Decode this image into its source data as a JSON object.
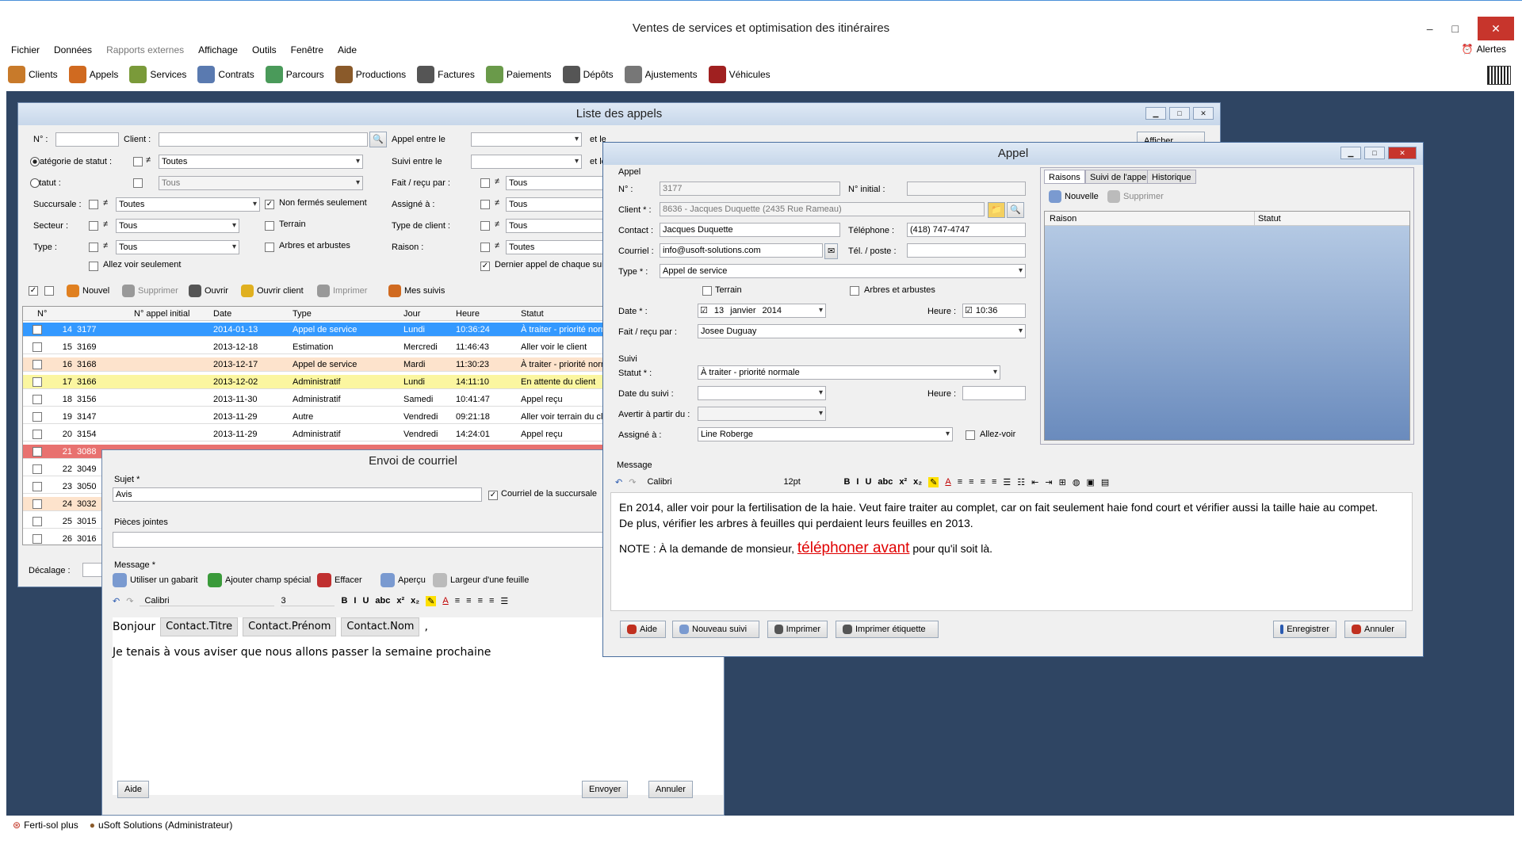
{
  "app": {
    "title": "Ventes de services et optimisation des itinéraires",
    "alerts": "Alertes"
  },
  "menu": [
    "Fichier",
    "Données",
    "Rapports externes",
    "Affichage",
    "Outils",
    "Fenêtre",
    "Aide"
  ],
  "toolbar": [
    {
      "label": "Clients",
      "icon": "clients-icon",
      "color": "#c87a2a"
    },
    {
      "label": "Appels",
      "icon": "appels-icon",
      "color": "#d06a20"
    },
    {
      "label": "Services",
      "icon": "services-icon",
      "color": "#7a9a3a"
    },
    {
      "label": "Contrats",
      "icon": "contrats-icon",
      "color": "#5a7ab0"
    },
    {
      "label": "Parcours",
      "icon": "parcours-icon",
      "color": "#4a9a5a"
    },
    {
      "label": "Productions",
      "icon": "productions-icon",
      "color": "#8a5a2a"
    },
    {
      "label": "Factures",
      "icon": "factures-icon",
      "color": "#555"
    },
    {
      "label": "Paiements",
      "icon": "paiements-icon",
      "color": "#6a9a4a"
    },
    {
      "label": "Dépôts",
      "icon": "depots-icon",
      "color": "#555"
    },
    {
      "label": "Ajustements",
      "icon": "ajustements-icon",
      "color": "#777"
    },
    {
      "label": "Véhicules",
      "icon": "vehicules-icon",
      "color": "#a02020"
    }
  ],
  "liste": {
    "title": "Liste des appels",
    "labels": {
      "no": "N° :",
      "client": "Client :",
      "categorie": "Catégorie de statut :",
      "statut": "Statut :",
      "succursale": "Succursale :",
      "secteur": "Secteur :",
      "type": "Type :",
      "appel_entre": "Appel entre le",
      "suivi_entre": "Suivi entre le",
      "et_le": "et le",
      "fait_recu": "Fait / reçu par :",
      "assigne": "Assigné à :",
      "type_client": "Type de client :",
      "raison": "Raison :",
      "non_fermes": "Non fermés seulement",
      "terrain": "Terrain",
      "arbres": "Arbres et arbustes",
      "allez_voir": "Allez voir seulement",
      "dernier": "Dernier appel de chaque sui",
      "decalage": "Décalage :",
      "afficher": "Afficher",
      "ne": "≠"
    },
    "values": {
      "categorie": "Toutes",
      "statut": "Tous",
      "succursale": "Toutes",
      "secteur": "Tous",
      "type": "Tous",
      "fait_recu": "Tous",
      "assigne": "Tous",
      "type_client": "Tous",
      "raison": "Toutes"
    },
    "actions": [
      "Nouvel",
      "Supprimer",
      "Ouvrir",
      "Ouvrir client",
      "Imprimer",
      "Mes suivis"
    ],
    "columns": [
      "N°",
      "N° appel initial",
      "Date",
      "Type",
      "Jour",
      "Heure",
      "Statut"
    ],
    "rows": [
      {
        "n": "14",
        "no": "3177",
        "date": "2014-01-13",
        "type": "Appel de service",
        "jour": "Lundi",
        "heure": "10:36:24",
        "statut": "À traiter - priorité normale",
        "color": "#3399ff",
        "text": "#fff"
      },
      {
        "n": "15",
        "no": "3169",
        "date": "2013-12-18",
        "type": "Estimation",
        "jour": "Mercredi",
        "heure": "11:46:43",
        "statut": "Aller voir le client",
        "color": "#ffffff",
        "text": "#000"
      },
      {
        "n": "16",
        "no": "3168",
        "date": "2013-12-17",
        "type": "Appel de service",
        "jour": "Mardi",
        "heure": "11:30:23",
        "statut": "À traiter - priorité normale",
        "color": "#fde3cc",
        "text": "#000"
      },
      {
        "n": "17",
        "no": "3166",
        "date": "2013-12-02",
        "type": "Administratif",
        "jour": "Lundi",
        "heure": "14:11:10",
        "statut": "En attente du client",
        "color": "#fbf6a0",
        "text": "#000"
      },
      {
        "n": "18",
        "no": "3156",
        "date": "2013-11-30",
        "type": "Administratif",
        "jour": "Samedi",
        "heure": "10:41:47",
        "statut": "Appel reçu",
        "color": "#ffffff",
        "text": "#000"
      },
      {
        "n": "19",
        "no": "3147",
        "date": "2013-11-29",
        "type": "Autre",
        "jour": "Vendredi",
        "heure": "09:21:18",
        "statut": "Aller voir terrain du client",
        "color": "#ffffff",
        "text": "#000"
      },
      {
        "n": "20",
        "no": "3154",
        "date": "2013-11-29",
        "type": "Administratif",
        "jour": "Vendredi",
        "heure": "14:24:01",
        "statut": "Appel reçu",
        "color": "#ffffff",
        "text": "#000"
      },
      {
        "n": "21",
        "no": "3088",
        "date": "",
        "type": "",
        "jour": "",
        "heure": "",
        "statut": "",
        "color": "#e8716f",
        "text": "#fff"
      },
      {
        "n": "22",
        "no": "3049",
        "date": "",
        "type": "",
        "jour": "",
        "heure": "",
        "statut": "",
        "color": "#ffffff",
        "text": "#000"
      },
      {
        "n": "23",
        "no": "3050",
        "date": "",
        "type": "",
        "jour": "",
        "heure": "",
        "statut": "",
        "color": "#ffffff",
        "text": "#000"
      },
      {
        "n": "24",
        "no": "3032",
        "date": "",
        "type": "",
        "jour": "",
        "heure": "",
        "statut": "",
        "color": "#fde3cc",
        "text": "#000"
      },
      {
        "n": "25",
        "no": "3015",
        "date": "",
        "type": "",
        "jour": "",
        "heure": "",
        "statut": "",
        "color": "#ffffff",
        "text": "#000"
      },
      {
        "n": "26",
        "no": "3016",
        "date": "",
        "type": "",
        "jour": "",
        "heure": "",
        "statut": "",
        "color": "#ffffff",
        "text": "#000"
      }
    ]
  },
  "courriel": {
    "title": "Envoi de courriel",
    "sujet_label": "Sujet *",
    "sujet": "Avis",
    "succursale_cb": "Courriel de la succursale",
    "pieces": "Pièces jointes",
    "message_label": "Message *",
    "tools": [
      "Utiliser un gabarit",
      "Ajouter champ spécial",
      "Effacer",
      "Aperçu",
      "Largeur d'une feuille"
    ],
    "font": "Calibri",
    "size": "3",
    "greeting": "Bonjour",
    "fields": [
      "Contact.Titre",
      "Contact.Prénom",
      "Contact.Nom"
    ],
    "comma": ",",
    "body": "Je tenais à vous aviser que nous allons passer la semaine prochaine",
    "aide": "Aide",
    "envoyer": "Envoyer",
    "annuler": "Annuler"
  },
  "appel": {
    "title": "Appel",
    "section_appel": "Appel",
    "section_suivi": "Suivi",
    "labels": {
      "no": "N° :",
      "no_initial": "N° initial :",
      "client": "Client * :",
      "contact": "Contact :",
      "telephone": "Téléphone :",
      "courriel": "Courriel :",
      "tel_poste": "Tél. / poste :",
      "type": "Type * :",
      "terrain": "Terrain",
      "arbres": "Arbres et arbustes",
      "date": "Date * :",
      "heure": "Heure :",
      "fait_recu": "Fait / reçu par :",
      "statut": "Statut * :",
      "date_suivi": "Date du suivi :",
      "avertir": "Avertir à partir du :",
      "assigne": "Assigné à :",
      "allez_voir": "Allez-voir",
      "message": "Message"
    },
    "values": {
      "no": "3177",
      "client": "8636 - Jacques Duquette  (2435 Rue Rameau)",
      "contact": "Jacques Duquette",
      "telephone": "(418) 747-4747",
      "courriel": "info@usoft-solutions.com",
      "type": "Appel de service",
      "date_day": "13",
      "date_month": "janvier",
      "date_year": "2014",
      "heure": "10:36",
      "fait_recu": "Josee Duguay",
      "statut": "À traiter - priorité normale",
      "assigne": "Line Roberge"
    },
    "tabs": [
      "Raisons",
      "Suivi de l'appel",
      "Historique"
    ],
    "nouvelle": "Nouvelle",
    "supprimer": "Supprimer",
    "grid_cols": [
      "Raison",
      "Statut"
    ],
    "font": "Calibri",
    "size": "12pt",
    "message_p1": "En 2014, aller voir pour la fertilisation de la haie. Veut faire traiter au complet, car on fait seulement haie fond court et vérifier aussi la taille haie au compet. De plus, vérifier les arbres à feuilles qui perdaient leurs feuilles en 2013.",
    "message_p2a": "NOTE : À la demande de monsieur, ",
    "message_p2b": "téléphoner avant",
    "message_p2c": " pour qu'il soit là.",
    "buttons": [
      "Aide",
      "Nouveau suivi",
      "Imprimer",
      "Imprimer étiquette",
      "Enregistrer",
      "Annuler"
    ]
  },
  "status": {
    "product": "Ferti-sol plus",
    "user": "uSoft Solutions (Administrateur)"
  }
}
